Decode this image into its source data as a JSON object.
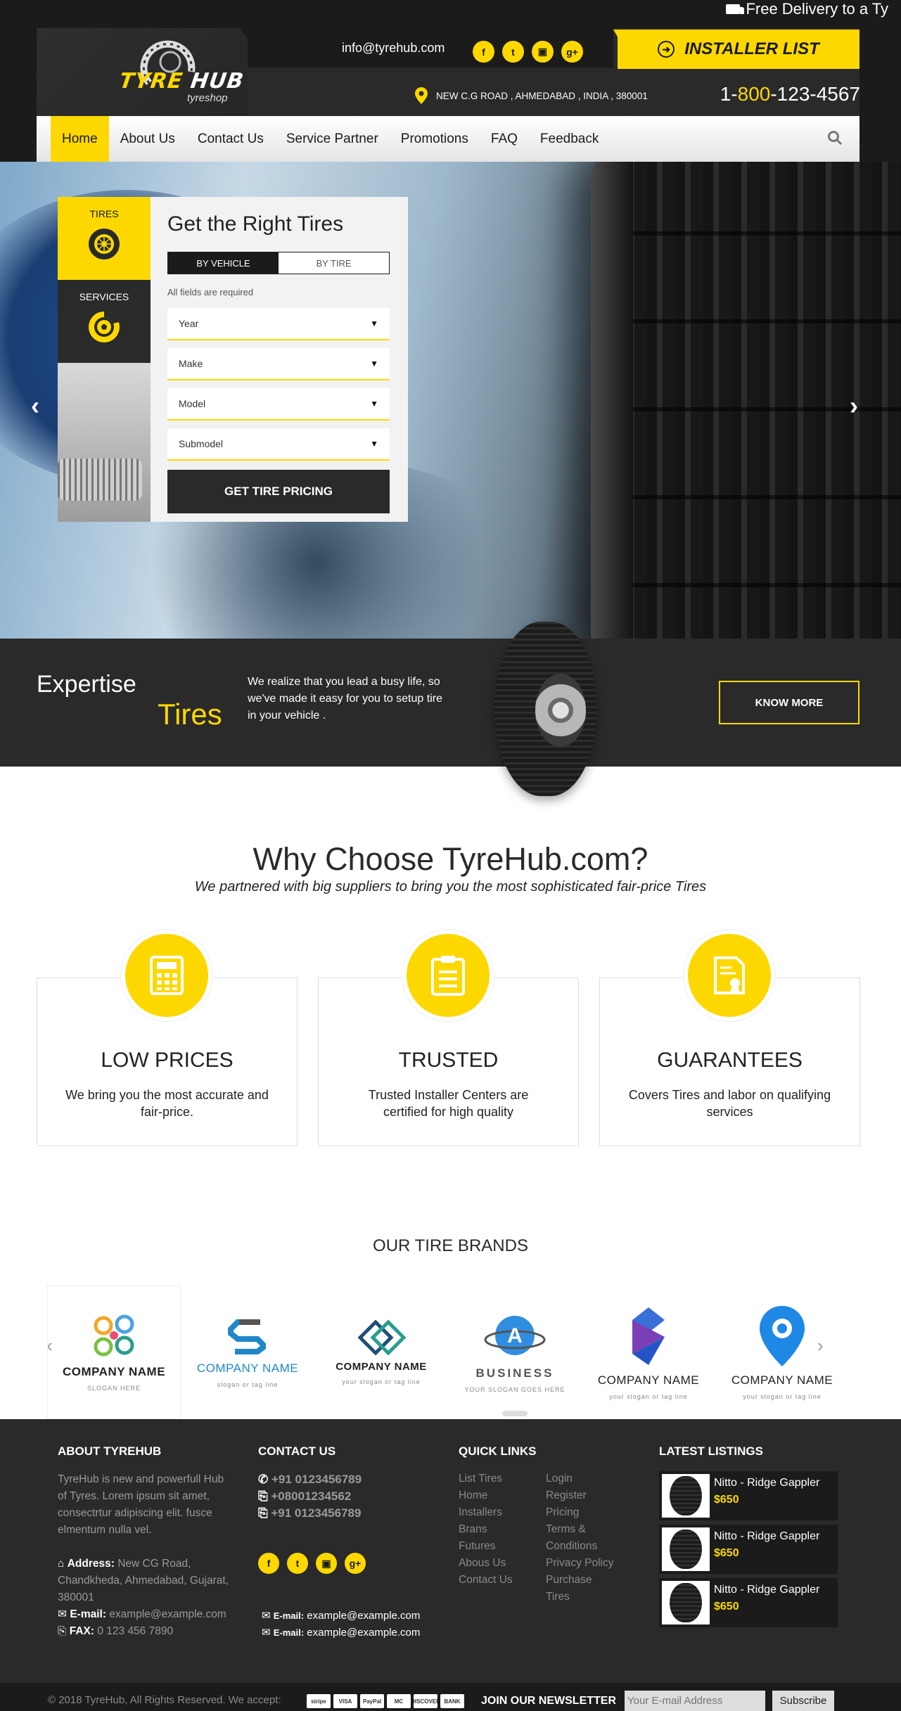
{
  "header": {
    "delivery_text": "Free Delivery to a Ty",
    "logo_text_1": "TYRE",
    "logo_text_2": "HUB",
    "logo_sub": "tyreshop",
    "email": "info@tyrehub.com",
    "social_icons": [
      "facebook-icon",
      "twitter-icon",
      "instagram-icon",
      "google-plus-icon"
    ],
    "installer_label": "INSTALLER LIST",
    "address": "NEW C.G ROAD , AHMEDABAD , INDIA , 380001",
    "phone_prefix": "1-",
    "phone_mid": "800",
    "phone_rest": "-123-4567"
  },
  "nav": {
    "items": [
      "Home",
      "About Us",
      "Contact Us",
      "Service Partner",
      "Promotions",
      "FAQ",
      "Feedback"
    ],
    "active": "Home"
  },
  "finder": {
    "tab_tires": "TIRES",
    "tab_services": "SERVICES",
    "title": "Get the Right Tires",
    "by_vehicle": "BY VEHICLE",
    "by_tire": "BY TIRE",
    "note": "All fields are required",
    "selects": [
      "Year",
      "Make",
      "Model",
      "Submodel"
    ],
    "button": "GET TIRE PRICING"
  },
  "expertise": {
    "title_1": "Expertise",
    "title_2": "Tires",
    "text": "We realize that you lead a busy life, so we've made it easy for you to setup tire in your vehicle .",
    "button": "KNOW MORE"
  },
  "why": {
    "title": "Why Choose TyreHub.com?",
    "subtitle": "We partnered with big suppliers to bring you the most sophisticated fair-price Tires",
    "cards": [
      {
        "title": "LOW PRICES",
        "text": "We bring you the most accurate and fair-price.",
        "icon": "calculator-icon"
      },
      {
        "title": "TRUSTED",
        "text": "Trusted Installer Centers are certified for high quality",
        "icon": "clipboard-icon"
      },
      {
        "title": "GUARANTEES",
        "text": "Covers Tires and labor on qualifying services",
        "icon": "certificate-icon"
      }
    ]
  },
  "brands": {
    "title": "OUR TIRE BRANDS",
    "items": [
      {
        "name": "COMPANY NAME",
        "slogan": "SLOGAN HERE"
      },
      {
        "name": "COMPANY NAME",
        "slogan": "slogan or tag line"
      },
      {
        "name": "COMPANY NAME",
        "slogan": "your slogan or tag line"
      },
      {
        "name": "BUSINESS",
        "slogan": "YOUR SLOGAN GOES HERE"
      },
      {
        "name": "COMPANY NAME",
        "slogan": "your slogan or tag line"
      },
      {
        "name": "COMPANY NAME",
        "slogan": "your slogan or tag line"
      }
    ]
  },
  "footer": {
    "about_title": "ABOUT TYREHUB",
    "about_text": "TyreHub is new and powerfull Hub of Tyres. Lorem ipsum sit amet, consectrtur adipiscing elit. fusce elmentum nulla vel.",
    "address_label": "Address:",
    "address_value": "New CG Road, Chandkheda, Ahmedabad, Gujarat, 380001",
    "email_label": "E-mail:",
    "email_value": "example@example.com",
    "fax_label": "FAX:",
    "fax_value": "0 123 456 7890",
    "contact_title": "CONTACT US",
    "phones": [
      "+91 0123456789",
      "+08001234562",
      "+91 0123456789"
    ],
    "contact_emails": [
      {
        "label": "E-mail:",
        "value": "example@example.com"
      },
      {
        "label": "E-mail:",
        "value": "example@example.com"
      }
    ],
    "links_title": "QUICK LINKS",
    "links_col1": [
      "List Tires",
      "Home",
      "Installers",
      "Brans",
      "Futures",
      "Abous Us",
      "Contact Us"
    ],
    "links_col2": [
      "Login",
      "Register",
      "Pricing",
      "Terms &",
      "Conditions",
      "Privacy Policy",
      "Purchase",
      "Tires"
    ],
    "listings_title": "LATEST LISTINGS",
    "listings": [
      {
        "name": "Nitto - Ridge Gappler",
        "price": "$650"
      },
      {
        "name": "Nitto - Ridge Gappler",
        "price": "$650"
      },
      {
        "name": "Nitto - Ridge Gappler",
        "price": "$650"
      }
    ],
    "copyright": "© 2018 TyreHub, All Rights Reserved. We accept:",
    "payment_cards": [
      "stripe",
      "VISA",
      "PayPal",
      "MC",
      "DISCOVER",
      "BANK"
    ],
    "newsletter_label": "JOIN OUR NEWSLETTER",
    "newsletter_placeholder": "Your E-mail Address",
    "newsletter_button": "Subscribe"
  },
  "colors": {
    "accent": "#fcd800",
    "dark": "#2a2a2a",
    "darker": "#1b1b1b"
  }
}
